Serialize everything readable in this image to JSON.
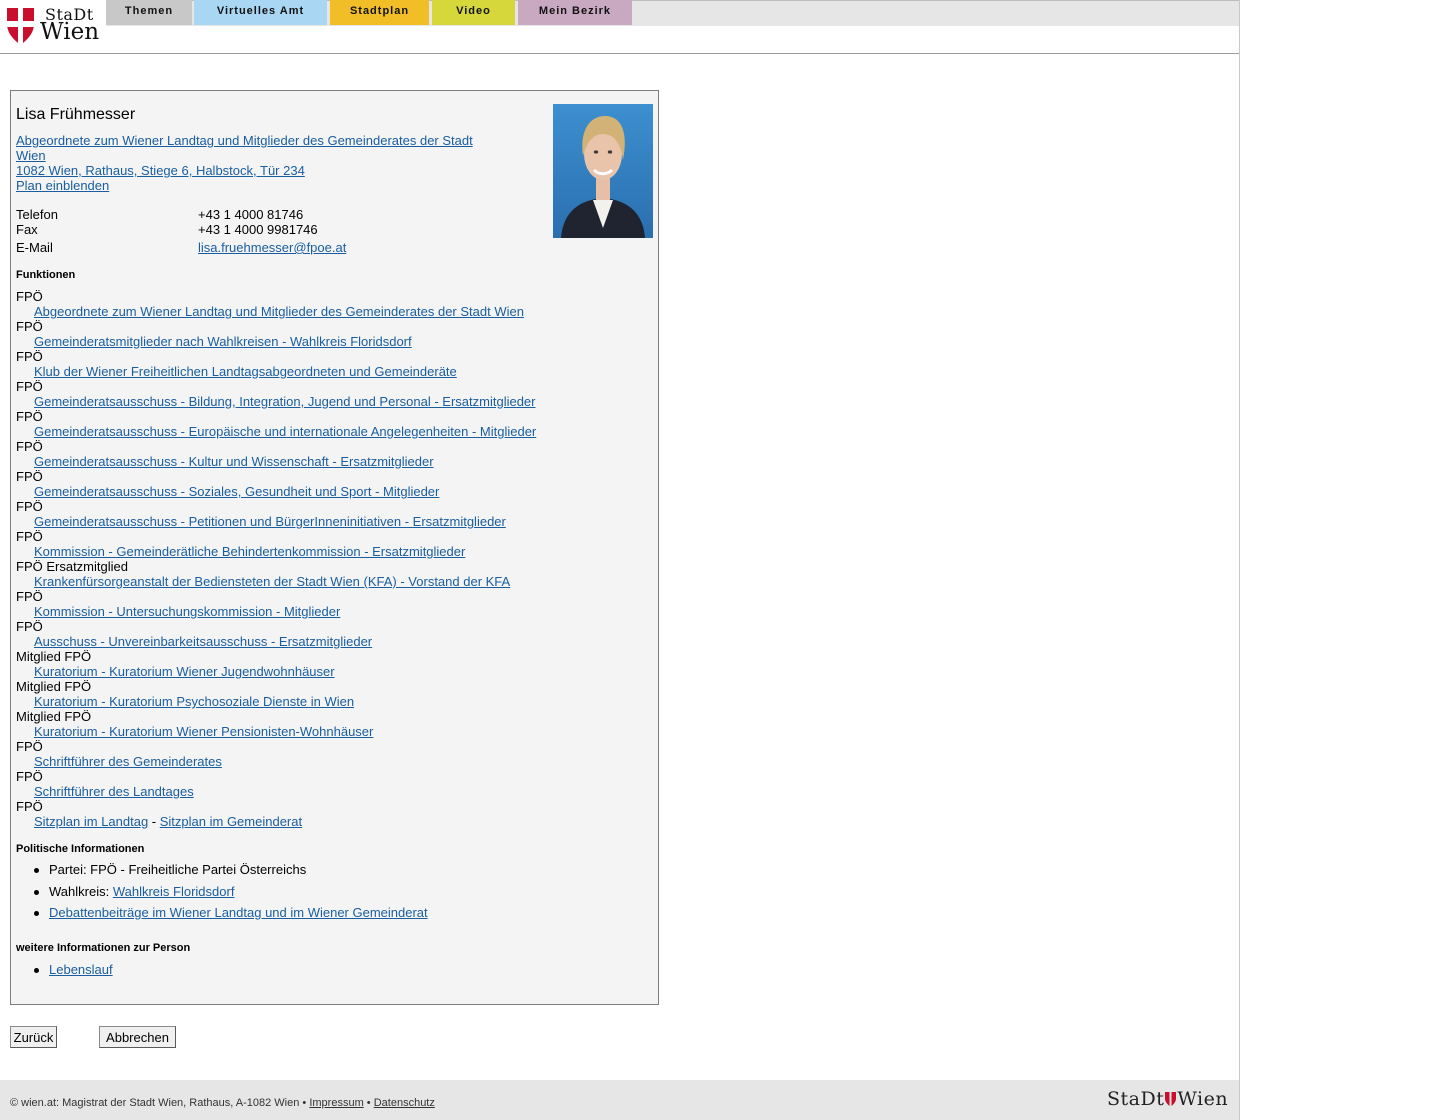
{
  "header": {
    "logo_top": "StaDt",
    "logo_bottom": "Wien",
    "tabs": [
      "Themen",
      "Virtuelles Amt",
      "Stadtplan",
      "Video",
      "Mein Bezirk"
    ]
  },
  "person": {
    "name": "Lisa Frühmesser",
    "role_line1": "Abgeordnete zum Wiener Landtag und Mitglieder des Gemeinderates der Stadt",
    "role_line2": "Wien",
    "address": "1082 Wien, Rathaus, Stiege 6, Halbstock, Tür 234",
    "plan_link": "Plan einblenden",
    "contact": {
      "phone_label": "Telefon",
      "phone": "+43 1 4000 81746",
      "fax_label": "Fax",
      "fax": "+43 1 4000 9981746",
      "email_label": "E-Mail",
      "email": "lisa.fruehmesser@fpoe.at"
    }
  },
  "functions": {
    "title": "Funktionen",
    "items": [
      {
        "party": "FPÖ",
        "link": "Abgeordnete zum Wiener Landtag und Mitglieder des Gemeinderates der Stadt Wien"
      },
      {
        "party": "FPÖ",
        "link": "Gemeinderatsmitglieder nach Wahlkreisen - Wahlkreis Floridsdorf"
      },
      {
        "party": "FPÖ",
        "link": "Klub der Wiener Freiheitlichen Landtagsabgeordneten und Gemeinderäte"
      },
      {
        "party": "FPÖ",
        "link": "Gemeinderatsausschuss - Bildung, Integration, Jugend und Personal - Ersatzmitglieder"
      },
      {
        "party": "FPÖ",
        "link": "Gemeinderatsausschuss - Europäische und internationale Angelegenheiten - Mitglieder"
      },
      {
        "party": "FPÖ",
        "link": "Gemeinderatsausschuss - Kultur und Wissenschaft - Ersatzmitglieder"
      },
      {
        "party": "FPÖ",
        "link": "Gemeinderatsausschuss - Soziales, Gesundheit und Sport - Mitglieder"
      },
      {
        "party": "FPÖ",
        "link": "Gemeinderatsausschuss - Petitionen und BürgerInneninitiativen - Ersatzmitglieder"
      },
      {
        "party": "FPÖ",
        "link": "Kommission - Gemeinderätliche Behindertenkommission - Ersatzmitglieder"
      },
      {
        "party": "FPÖ Ersatzmitglied",
        "link": "Krankenfürsorgeanstalt der Bediensteten der Stadt Wien (KFA) - Vorstand der KFA"
      },
      {
        "party": "FPÖ",
        "link": "Kommission - Untersuchungskommission - Mitglieder"
      },
      {
        "party": "FPÖ",
        "link": "Ausschuss - Unvereinbarkeitsausschuss - Ersatzmitglieder"
      },
      {
        "party": "Mitglied FPÖ",
        "link": "Kuratorium - Kuratorium Wiener Jugendwohnhäuser"
      },
      {
        "party": "Mitglied FPÖ",
        "link": "Kuratorium - Kuratorium Psychosoziale Dienste in Wien"
      },
      {
        "party": "Mitglied FPÖ",
        "link": "Kuratorium - Kuratorium Wiener Pensionisten-Wohnhäuser"
      },
      {
        "party": "FPÖ",
        "link": "Schriftführer des Gemeinderates"
      },
      {
        "party": "FPÖ",
        "link": "Schriftführer des Landtages"
      }
    ],
    "last": {
      "party": "FPÖ",
      "link_a": "Sitzplan im Landtag",
      "sep": " - ",
      "link_b": "Sitzplan im Gemeinderat"
    }
  },
  "political": {
    "title": "Politische Informationen",
    "party": "Partei: FPÖ - Freiheitliche Partei Österreichs",
    "district_label": "Wahlkreis:",
    "district_link": "Wahlkreis Floridsdorf",
    "debates_link": "Debattenbeiträge im Wiener Landtag und im Wiener Gemeinderat"
  },
  "further": {
    "title": "weitere Informationen zur Person",
    "cv_link": "Lebenslauf"
  },
  "buttons": {
    "back": "Zurück",
    "cancel": "Abbrechen"
  },
  "footer": {
    "text": "© wien.at: Magistrat der Stadt Wien, Rathaus, A-1082 Wien •",
    "impressum": "Impressum",
    "sep": "•",
    "datenschutz": "Datenschutz",
    "logo_left": "StaDt",
    "logo_right": "Wien"
  },
  "colors": {
    "link": "#1a5ea0",
    "tab_themen": "#c8c8c8",
    "tab_amt": "#a9d6f3",
    "tab_plan": "#f1be27",
    "tab_video": "#d5d73a",
    "tab_bezirk": "#c9a9c1",
    "vienna_red": "#c8102e"
  }
}
